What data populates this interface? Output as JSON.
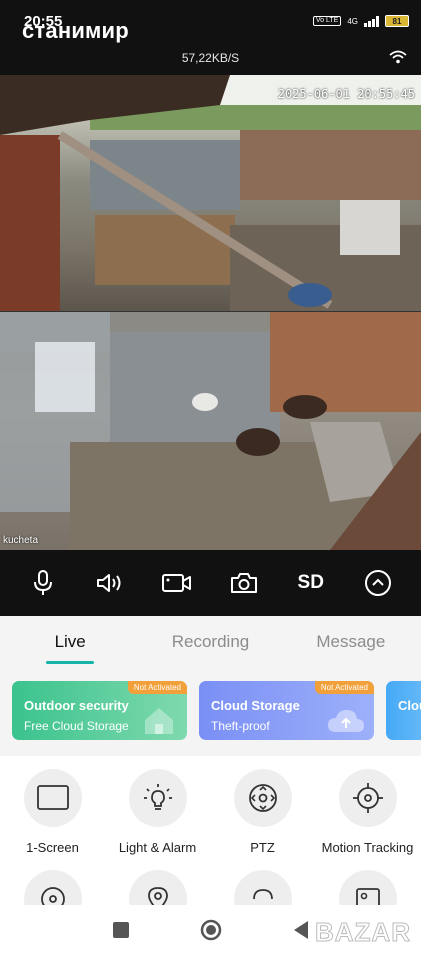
{
  "status_bar": {
    "time": "20:55",
    "network_type": "4G",
    "volte": "Vo LTE",
    "battery": "81"
  },
  "header": {
    "device_title": "станимир",
    "data_rate": "57,22KB/S"
  },
  "camera": {
    "timestamp": "2025-06-01 20:55:45",
    "camera_name": "kucheta"
  },
  "controls": {
    "sd_label": "SD"
  },
  "tabs": [
    {
      "label": "Live",
      "active": true
    },
    {
      "label": "Recording",
      "active": false
    },
    {
      "label": "Message",
      "active": false
    }
  ],
  "promos": [
    {
      "title": "Outdoor security",
      "subtitle": "Free Cloud Storage",
      "badge": "Not Activated"
    },
    {
      "title": "Cloud Storage",
      "subtitle": "Theft-proof",
      "badge": "Not Activated"
    },
    {
      "title": "Clou",
      "subtitle": "",
      "badge": ""
    }
  ],
  "features": [
    {
      "label": "1-Screen",
      "icon": "screen-icon"
    },
    {
      "label": "Light & Alarm",
      "icon": "bulb-icon"
    },
    {
      "label": "PTZ",
      "icon": "ptz-icon"
    },
    {
      "label": "Motion Tracking",
      "icon": "target-icon"
    }
  ],
  "watermark": "BAZAR",
  "colors": {
    "accent": "#15b3a8",
    "badge": "#f2a03a",
    "card_green": "#3bc38d",
    "card_purple": "#7a8ff5",
    "card_blue": "#45a9f5"
  }
}
